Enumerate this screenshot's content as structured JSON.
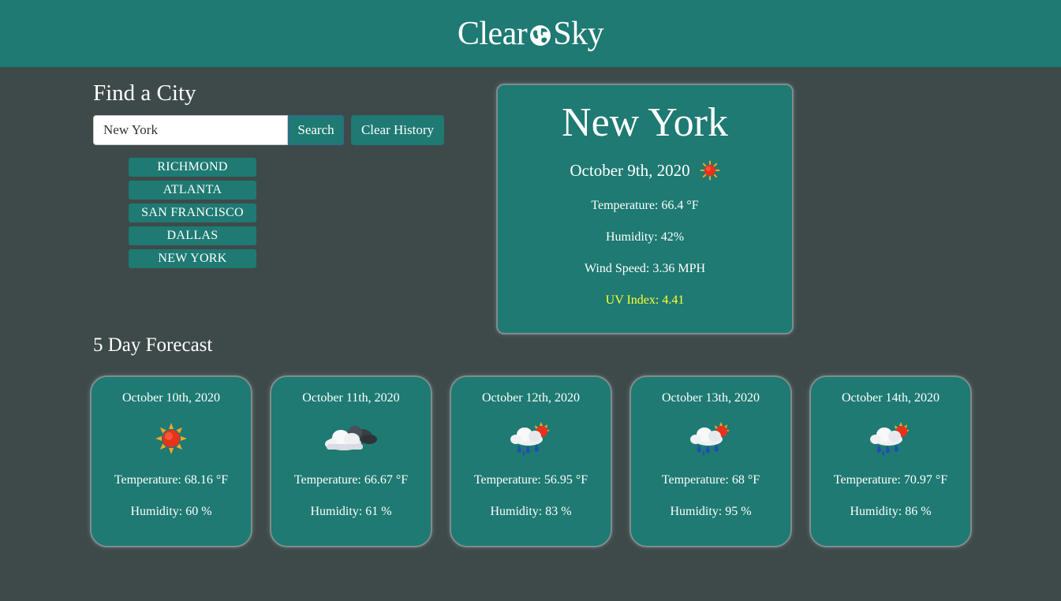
{
  "header": {
    "brand_left": "Clear",
    "brand_right": "Sky",
    "brand_icon": "globe-icon",
    "bg_color": "#1e7a72"
  },
  "search": {
    "title": "Find a City",
    "input_value": "New York",
    "search_label": "Search",
    "clear_label": "Clear History"
  },
  "history": [
    {
      "label": "RICHMOND"
    },
    {
      "label": "ATLANTA"
    },
    {
      "label": "SAN FRANCISCO"
    },
    {
      "label": "DALLAS"
    },
    {
      "label": "NEW YORK"
    }
  ],
  "current": {
    "city": "New York",
    "date": "October 9th, 2020",
    "icon": "sun-icon",
    "temperature": "Temperature: 66.4 °F",
    "humidity": "Humidity: 42%",
    "wind": "Wind Speed: 3.36 MPH",
    "uv": "UV Index: 4.41",
    "uv_color": "#ffff33"
  },
  "forecast": {
    "title": "5 Day Forecast",
    "days": [
      {
        "date": "October 10th, 2020",
        "icon": "sun-icon",
        "temperature": "Temperature: 68.16 °F",
        "humidity": "Humidity: 60 %"
      },
      {
        "date": "October 11th, 2020",
        "icon": "cloud-icon",
        "temperature": "Temperature: 66.67 °F",
        "humidity": "Humidity: 61 %"
      },
      {
        "date": "October 12th, 2020",
        "icon": "rain-sun-icon",
        "temperature": "Temperature: 56.95 °F",
        "humidity": "Humidity: 83 %"
      },
      {
        "date": "October 13th, 2020",
        "icon": "rain-sun-icon",
        "temperature": "Temperature: 68 °F",
        "humidity": "Humidity: 95 %"
      },
      {
        "date": "October 14th, 2020",
        "icon": "rain-sun-icon",
        "temperature": "Temperature: 70.97 °F",
        "humidity": "Humidity: 86 %"
      }
    ]
  }
}
